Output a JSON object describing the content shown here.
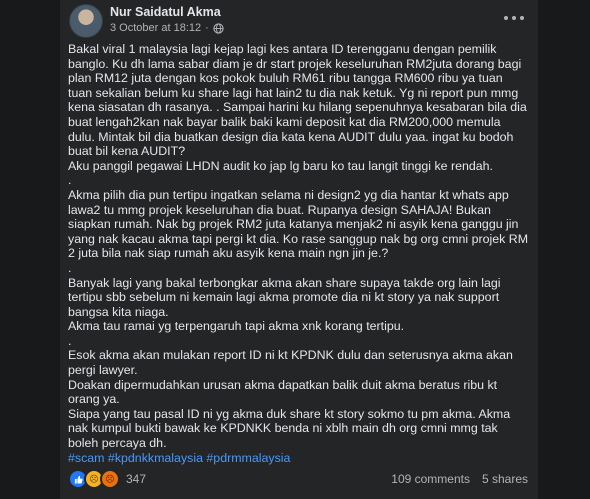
{
  "post": {
    "author": "Nur Saidatul Akma",
    "timestamp": "3 October at 18:12",
    "separator": "·",
    "paragraphs": [
      "Bakal viral 1 malaysia lagi kejap lagi kes antara ID terengganu dengan pemilik banglo. Ku dh lama sabar diam je dr start projek keseluruhan RM2juta dorang bagi plan RM12 juta dengan kos pokok buluh RM61 ribu tangga RM600 ribu ya tuan tuan sekalian belum ku share lagi hat lain2 tu dia nak ketuk. Yg ni report pun mmg kena siasatan dh rasanya. . Sampai harini ku hilang sepenuhnya kesabaran bila dia buat lengah2kan nak bayar balik baki kami deposit kat dia RM200,000 memula dulu. Mintak bil dia buatkan design dia kata kena AUDIT dulu yaa. ingat ku bodoh buat bil kena AUDIT?",
      "Aku panggil pegawai LHDN audit ko jap lg baru ko tau langit tinggi ke rendah.",
      ".",
      "Akma pilih dia pun tertipu ingatkan selama ni design2 yg dia hantar kt whats app lawa2 tu mmg projek keseluruhan dia buat. Rupanya design SAHAJA! Bukan siapkan rumah. Nak bg projek RM2 juta katanya menjak2 ni asyik kena ganggu jin yang nak kacau akma tapi pergi kt dia. Ko rase sanggup nak bg org cmni projek RM 2 juta bila nak siap rumah aku asyik kena main ngn jin je.?",
      ".",
      "Banyak lagi yang bakal terbongkar akma akan share supaya takde org lain lagi tertipu sbb sebelum ni kemain lagi akma promote dia ni kt story ya nak support bangsa kita niaga.",
      "Akma tau ramai yg terpengaruh tapi akma xnk korang tertipu.",
      ".",
      "Esok akma akan mulakan report ID ni kt KPDNK dulu dan seterusnya akma akan pergi lawyer.",
      "Doakan dipermudahkan urusan akma dapatkan balik duit akma beratus ribu kt orang ya.",
      "Siapa yang tau pasal ID ni yg akma duk share kt story sokmo tu pm akma. Akma nak kumpul bukti bawak ke KPDNKK benda ni xblh main dh org cmni mmg tak boleh percaya dh."
    ],
    "hashtags": "#scam #kpdnkkmalaysia #pdrmmalaysia",
    "reaction_count": "347",
    "comments": "109 comments",
    "shares": "5 shares"
  },
  "icons": {
    "audience": "globe-icon",
    "menu": "more-options-icon",
    "reactions": [
      "like-reaction-icon",
      "sad-reaction-icon",
      "angry-reaction-icon"
    ]
  },
  "colors": {
    "card_bg": "#242526",
    "page_bg": "#18191a",
    "text": "#e4e6eb",
    "secondary_text": "#b0b3b8",
    "hashtag": "#4599ff",
    "like": "#2078f4"
  }
}
